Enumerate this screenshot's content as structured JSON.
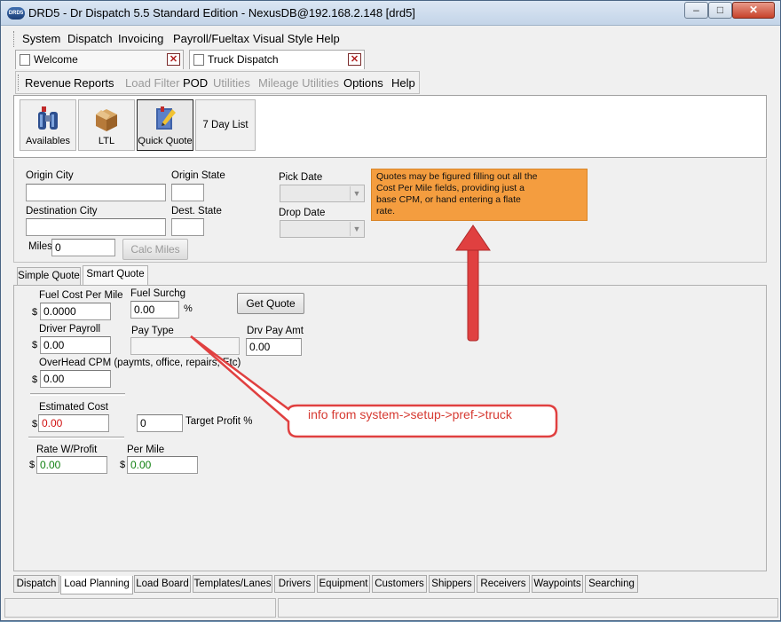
{
  "window": {
    "title": "DRD5 - Dr Dispatch 5.5 Standard Edition - NexusDB@192.168.2.148 [drd5]",
    "app_icon_text": "DRD5"
  },
  "menu": {
    "items": [
      "System",
      "Dispatch",
      "Invoicing",
      "Payroll/Fueltax",
      "Visual Style",
      "Help"
    ]
  },
  "doc_tabs": [
    "Welcome",
    "Truck Dispatch"
  ],
  "submenu": {
    "items": [
      {
        "label": "Revenue",
        "enabled": true
      },
      {
        "label": "Reports",
        "enabled": true
      },
      {
        "label": "Load Filter",
        "enabled": false
      },
      {
        "label": "POD",
        "enabled": true
      },
      {
        "label": "Utilities",
        "enabled": false
      },
      {
        "label": "Mileage Utilities",
        "enabled": false
      },
      {
        "label": "Options",
        "enabled": true
      },
      {
        "label": "Help",
        "enabled": true
      }
    ]
  },
  "toolbar": {
    "buttons": [
      "Availables",
      "LTL",
      "Quick Quote",
      "7 Day List"
    ],
    "active": "Quick Quote"
  },
  "form": {
    "origin_city_label": "Origin City",
    "origin_city_value": "",
    "origin_state_label": "Origin State",
    "origin_state_value": "",
    "destination_city_label": "Destination City",
    "destination_city_value": "",
    "dest_state_label": "Dest. State",
    "dest_state_value": "",
    "miles_label": "Miles",
    "miles_value": "0",
    "calc_miles_label": "Calc Miles",
    "pick_date_label": "Pick Date",
    "drop_date_label": "Drop Date",
    "note": "Quotes may be figured filling out all the Cost Per Mile fields, providing just a base CPM, or hand entering a flate rate."
  },
  "quote_tabs": {
    "items": [
      "Simple Quote",
      "Smart Quote"
    ],
    "active": "Smart Quote"
  },
  "smart_quote": {
    "currency": "$",
    "fuel_cost_label": "Fuel Cost Per Mile",
    "fuel_cost_value": "0.0000",
    "fuel_surchg_label": "Fuel Surchg",
    "fuel_surchg_value": "0.00",
    "percent": "%",
    "get_quote_label": "Get Quote",
    "driver_payroll_label": "Driver Payroll",
    "driver_payroll_value": "0.00",
    "pay_type_label": "Pay Type",
    "pay_type_value": "",
    "drv_pay_amt_label": "Drv Pay Amt",
    "drv_pay_amt_value": "0.00",
    "overhead_label": "OverHead CPM (paymts, office, repairs, Etc)",
    "overhead_value": "0.00",
    "estimated_cost_label": "Estimated Cost",
    "estimated_cost_value": "0.00",
    "target_profit_value": "0",
    "target_profit_label": "Target Profit %",
    "rate_label": "Rate W/Profit",
    "rate_value": "0.00",
    "per_mile_label": "Per Mile",
    "per_mile_value": "0.00"
  },
  "bottom_tabs": {
    "items": [
      "Dispatch",
      "Load Planning",
      "Load Board",
      "Templates/Lanes",
      "Drivers",
      "Equipment",
      "Customers",
      "Shippers",
      "Receivers",
      "Waypoints",
      "Searching"
    ],
    "active": "Load Planning"
  },
  "annotation": {
    "callout": "info from system->setup->pref->truck",
    "color": "#d63a32"
  },
  "colors": {
    "note_bg": "#f49d3f",
    "annotation_red": "#e04040",
    "titlebar": "#c3d4e8"
  }
}
